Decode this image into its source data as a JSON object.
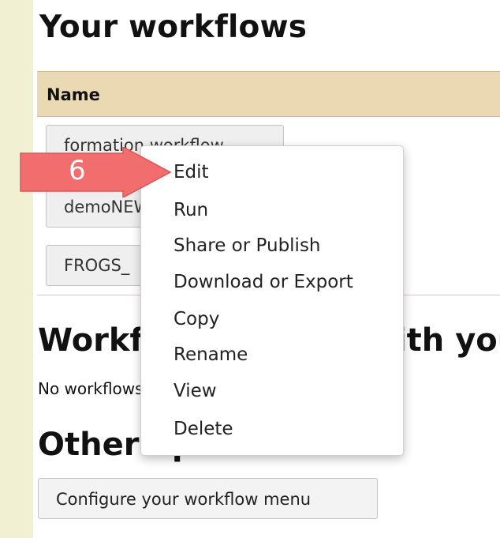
{
  "headings": {
    "your_workflows": "Your workflows",
    "shared_with_you": "Workflows shared with you",
    "other_options": "Other options"
  },
  "table": {
    "column_name": "Name"
  },
  "workflows": [
    {
      "label": "formation workflow"
    },
    {
      "label": "demoNEW"
    },
    {
      "label": "FROGS_"
    }
  ],
  "shared_empty_text": "No workflows have been shared with you.",
  "configure_button": "Configure your workflow menu",
  "context_menu": {
    "items": [
      "Edit",
      "Run",
      "Share or Publish",
      "Download or Export",
      "Copy",
      "Rename",
      "View",
      "Delete"
    ]
  },
  "callout": {
    "number": "6",
    "color": "#f26d6d"
  }
}
